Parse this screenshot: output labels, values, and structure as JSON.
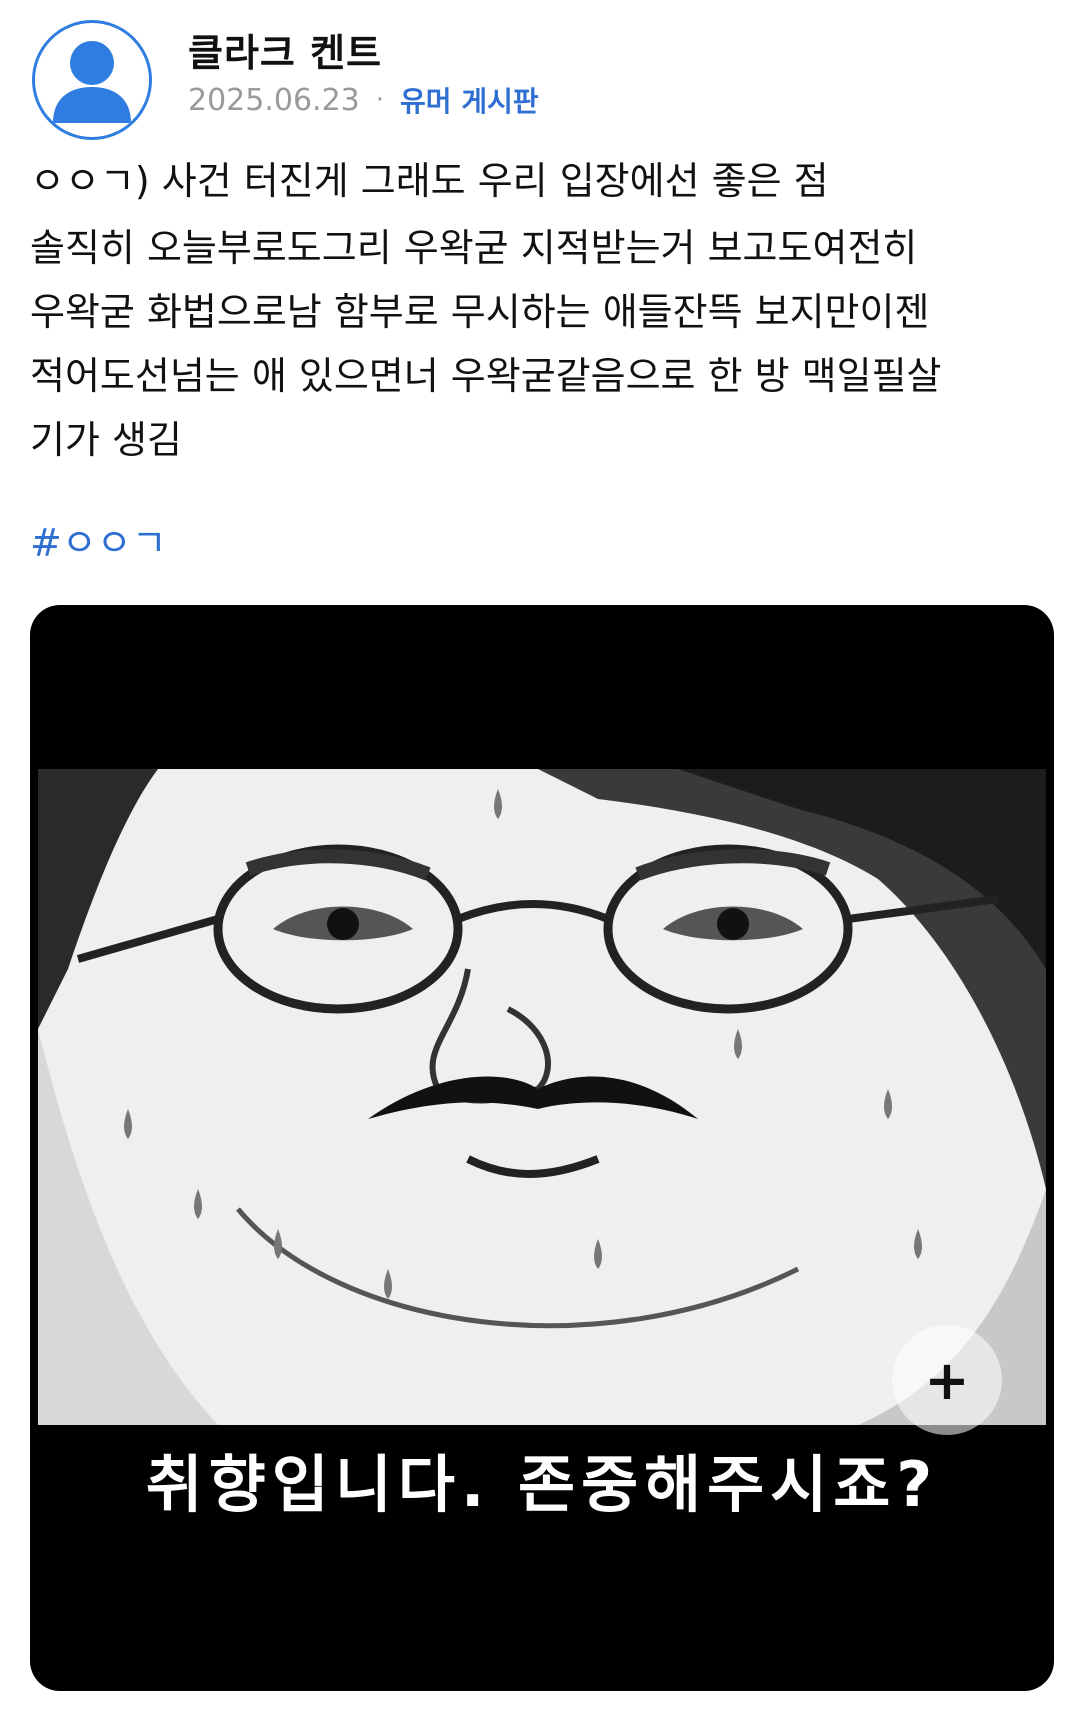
{
  "header": {
    "author": "클라크 켄트",
    "date": "2025.06.23",
    "separator": "·",
    "board": "유머 게시판"
  },
  "post": {
    "title": "ㅇㅇㄱ) 사건 터진게 그래도 우리 입장에선 좋은 점",
    "body_lines": [
      "솔직히 오늘부로도그리 우왁굳 지적받는거 보고도여전히",
      "우왁굳 화법으로남 함부로 무시하는 애들잔뜩 보지만이젠",
      "적어도선넘는 애 있으면너 우왁굳같음으로 한 방 맥일필살",
      "기가 생김"
    ],
    "hashtag": "#ㅇㅇㄱ"
  },
  "media": {
    "caption": "취향입니다.  존중해주시죠?",
    "expand_icon": "plus-icon",
    "expand_label": "+"
  },
  "colors": {
    "accent": "#2f6fd1",
    "avatar_ring": "#2f7de1",
    "meta_gray": "#9a9a9a"
  }
}
